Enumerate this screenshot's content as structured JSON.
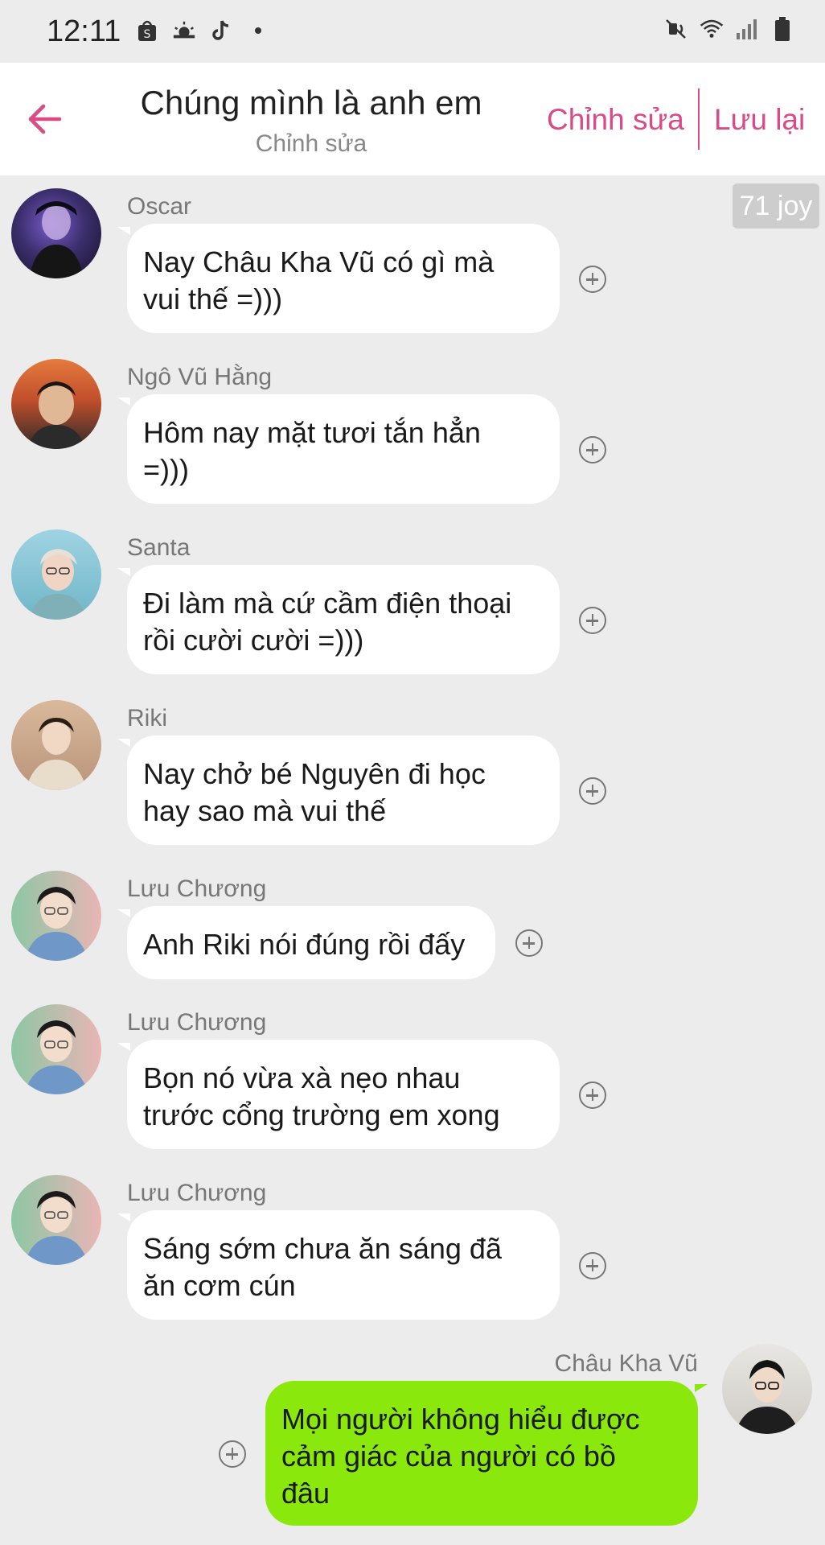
{
  "status_bar": {
    "time": "12:11",
    "icons": [
      "shopee-icon",
      "weather-icon",
      "tiktok-icon",
      "notification-dot",
      "mute-icon",
      "wifi-icon",
      "signal-icon",
      "battery-icon"
    ]
  },
  "header": {
    "title": "Chúng mình là anh em",
    "subtitle": "Chỉnh sửa",
    "edit_label": "Chỉnh sửa",
    "save_label": "Lưu lại",
    "accent_color": "#d94a87"
  },
  "joy_badge": "71 joy",
  "messages": [
    {
      "sender": "Oscar",
      "text": "Nay Châu Kha Vũ có gì mà\nvui thế =)))"
    },
    {
      "sender": "Ngô Vũ Hằng",
      "text": "Hôm nay mặt tươi tắn hẳn\n=)))"
    },
    {
      "sender": "Santa",
      "text": "Đi làm mà cứ cầm điện thoại\nrồi cười cười =)))"
    },
    {
      "sender": "Riki",
      "text": "Nay chở bé Nguyên đi học\nhay sao mà vui thế"
    },
    {
      "sender": "Lưu Chương",
      "text": "Anh Riki nói đúng rồi đấy"
    },
    {
      "sender": "Lưu Chương",
      "text": "Bọn nó vừa xà nẹo nhau\ntrước cổng trường em xong"
    },
    {
      "sender": "Lưu Chương",
      "text": "Sáng sớm chưa ăn sáng đã\năn cơm cún"
    },
    {
      "sender": "Châu Kha Vũ",
      "text": "Mọi người không hiểu được\ncảm giác của người có bồ\nđâu",
      "mine": true
    }
  ],
  "colors": {
    "my_bubble": "#8be80c",
    "other_bubble": "#ffffff",
    "background": "#ececec"
  }
}
